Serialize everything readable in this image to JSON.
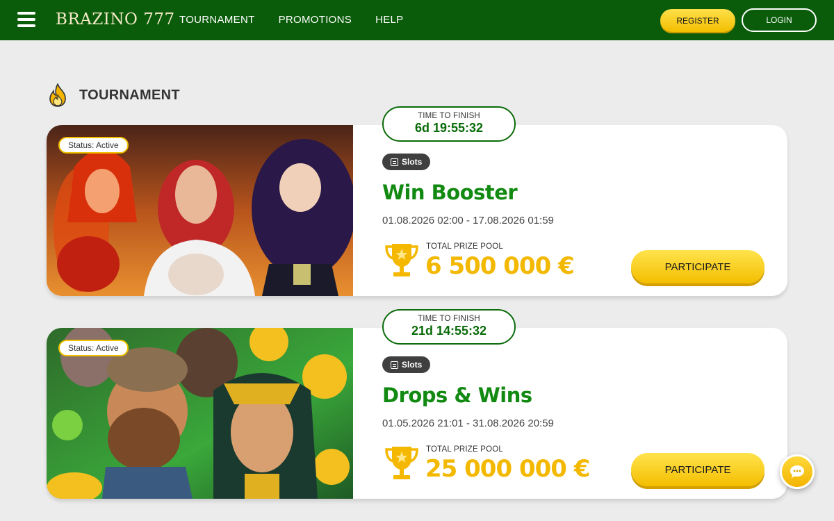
{
  "header": {
    "logo": "BRAZINO 777",
    "nav": [
      "TOURNAMENT",
      "PROMOTIONS",
      "HELP"
    ],
    "register_label": "REGISTER",
    "login_label": "LOGIN"
  },
  "section": {
    "title": "TOURNAMENT",
    "icon": "flame-icon"
  },
  "tournaments": [
    {
      "status": "Status: Active",
      "timer_label": "TIME TO FINISH",
      "timer_value": "6d 19:55:32",
      "tag": "Slots",
      "title": "Win Booster",
      "dates": "01.08.2026 02:00 - 17.08.2026 01:59",
      "prize_label": "TOTAL PRIZE POOL",
      "prize_value": "6 500 000 €",
      "button": "PARTICIPATE"
    },
    {
      "status": "Status: Active",
      "timer_label": "TIME TO FINISH",
      "timer_value": "21d 14:55:32",
      "tag": "Slots",
      "title": "Drops & Wins",
      "dates": "01.05.2026 21:01 - 31.08.2026 20:59",
      "prize_label": "TOTAL PRIZE POOL",
      "prize_value": "25 000 000 €",
      "button": "PARTICIPATE"
    }
  ],
  "colors": {
    "header_bg": "#0a5c0a",
    "accent_green": "#128a12",
    "accent_yellow": "#f3b800",
    "page_bg": "#ececec"
  },
  "chat": {
    "icon": "chat-bubble-icon"
  }
}
